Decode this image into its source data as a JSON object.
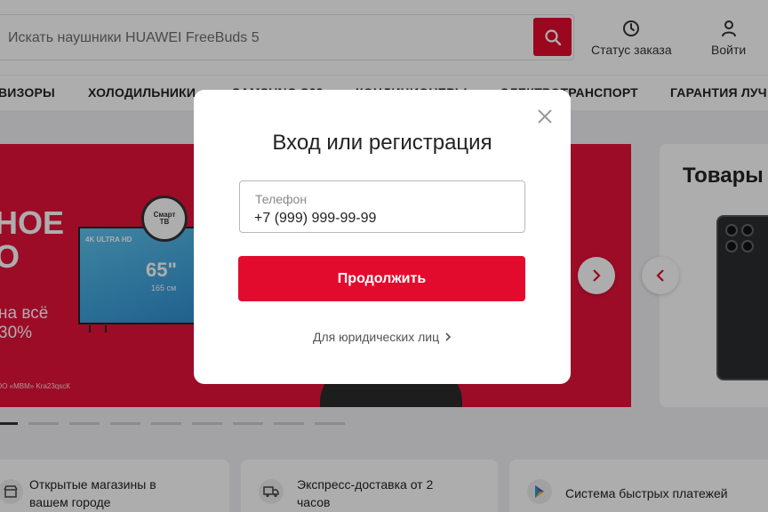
{
  "search": {
    "placeholder": "Искать наушники HUAWEI FreeBuds 5"
  },
  "header": {
    "order_status": "Статус заказа",
    "login": "Войти"
  },
  "categories": [
    "ВИЗОРЫ",
    "ХОЛОДИЛЬНИКИ",
    "SAMSUNG S23",
    "КОНДИЦИОНЕРЫ",
    "ЭЛЕКТРОТРАНСПОРТ",
    "ГАРАНТИЯ ЛУЧ"
  ],
  "banner": {
    "headline_1": "НОЕ",
    "headline_2": "О",
    "sub_1": "на всё",
    "sub_2": "30%",
    "note": "ОО «МВМ» Kra23qsсК",
    "tv_label": "4K ULTRA HD",
    "tv_size": "65\"",
    "tv_cm": "165 см",
    "badge_1": "Смарт",
    "badge_2": "ТВ",
    "color": "#e6123a"
  },
  "product_card": {
    "title": "Товары"
  },
  "features": [
    {
      "icon": "shop-icon",
      "text_1": "Открытые магазины в",
      "text_2": "вашем городе"
    },
    {
      "icon": "delivery-icon",
      "text_1": "Экспресс-доставка от 2",
      "text_2": "часов"
    },
    {
      "icon": "sbp-icon",
      "text_1": "Система быстрых платежей",
      "text_2": ""
    }
  ],
  "modal": {
    "title": "Вход или регистрация",
    "phone_label": "Телефон",
    "phone_value": "+7 (999) 999-99-99",
    "continue_label": "Продолжить",
    "legal_link": "Для юридических лиц"
  },
  "colors": {
    "accent": "#e30b2d"
  }
}
